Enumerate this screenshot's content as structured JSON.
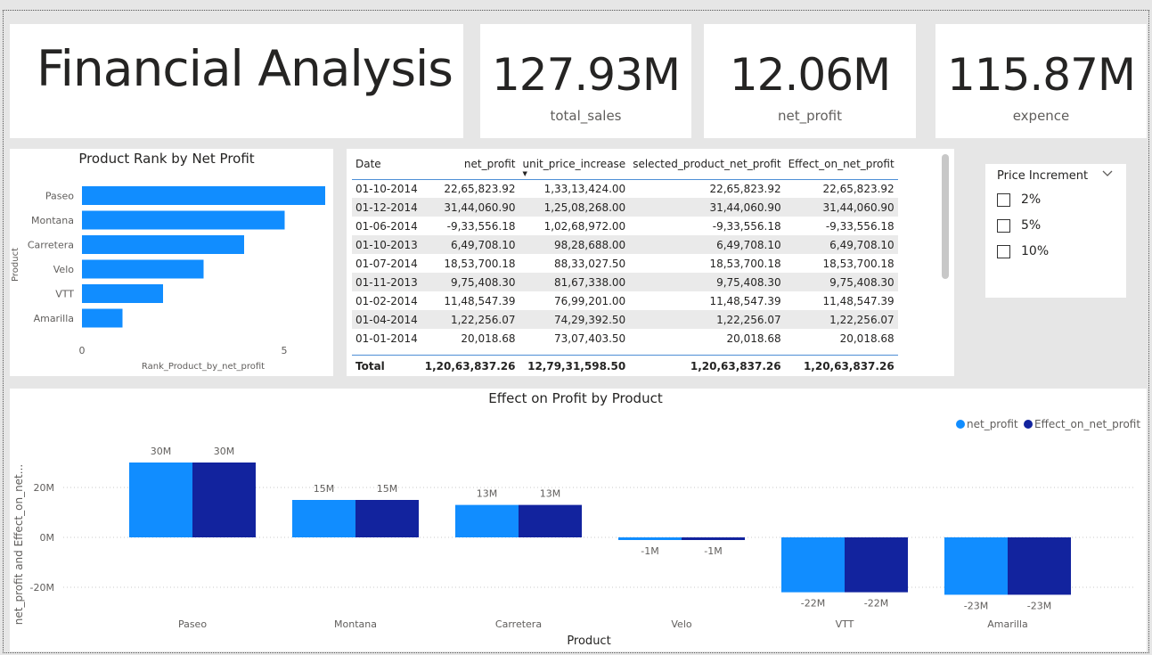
{
  "header": {
    "title": "Financial Analysis"
  },
  "kpis": [
    {
      "value": "127.93M",
      "label": "total_sales"
    },
    {
      "value": "12.06M",
      "label": "net_profit"
    },
    {
      "value": "115.87M",
      "label": "expence"
    }
  ],
  "rank_chart": {
    "title": "Product Rank by Net Profit",
    "xlabel": "Rank_Product_by_net_profit",
    "ylabel": "Product",
    "tick_labels": [
      "0",
      "5"
    ]
  },
  "table": {
    "columns": [
      "Date",
      "net_profit",
      "unit_price_increase",
      "selected_product_net_profit",
      "Effect_on_net_profit"
    ],
    "rows": [
      [
        "01-10-2014",
        "22,65,823.92",
        "1,33,13,424.00",
        "22,65,823.92",
        "22,65,823.92"
      ],
      [
        "01-12-2014",
        "31,44,060.90",
        "1,25,08,268.00",
        "31,44,060.90",
        "31,44,060.90"
      ],
      [
        "01-06-2014",
        "-9,33,556.18",
        "1,02,68,972.00",
        "-9,33,556.18",
        "-9,33,556.18"
      ],
      [
        "01-10-2013",
        "6,49,708.10",
        "98,28,688.00",
        "6,49,708.10",
        "6,49,708.10"
      ],
      [
        "01-07-2014",
        "18,53,700.18",
        "88,33,027.50",
        "18,53,700.18",
        "18,53,700.18"
      ],
      [
        "01-11-2013",
        "9,75,408.30",
        "81,67,338.00",
        "9,75,408.30",
        "9,75,408.30"
      ],
      [
        "01-02-2014",
        "11,48,547.39",
        "76,99,201.00",
        "11,48,547.39",
        "11,48,547.39"
      ],
      [
        "01-04-2014",
        "1,22,256.07",
        "74,29,392.50",
        "1,22,256.07",
        "1,22,256.07"
      ],
      [
        "01-01-2014",
        "20,018.68",
        "73,07,403.50",
        "20,018.68",
        "20,018.68"
      ]
    ],
    "total": [
      "Total",
      "1,20,63,837.26",
      "12,79,31,598.50",
      "1,20,63,837.26",
      "1,20,63,837.26"
    ]
  },
  "slicer": {
    "title": "Price Increment",
    "options": [
      "2%",
      "5%",
      "10%"
    ]
  },
  "effect_chart": {
    "title": "Effect on Profit by Product",
    "xlabel": "Product",
    "ylabel": "net_profit and Effect_on_net...",
    "tick_labels": [
      "20M",
      "0M",
      "-20M"
    ],
    "data_labels_a": [
      "30M",
      "15M",
      "13M",
      "-1M",
      "-22M",
      "-23M"
    ],
    "data_labels_b": [
      "30M",
      "15M",
      "13M",
      "-1M",
      "-22M",
      "-23M"
    ]
  },
  "chart_data": [
    {
      "type": "bar",
      "orientation": "horizontal",
      "title": "Product Rank by Net Profit",
      "xlabel": "Rank_Product_by_net_profit",
      "ylabel": "Product",
      "categories": [
        "Paseo",
        "Montana",
        "Carretera",
        "Velo",
        "VTT",
        "Amarilla"
      ],
      "values": [
        6,
        5,
        4,
        3,
        2,
        1
      ],
      "xlim": [
        0,
        6
      ],
      "grid": false,
      "colors": [
        "#118dff"
      ]
    },
    {
      "type": "bar",
      "title": "Effect on Profit by Product",
      "xlabel": "Product",
      "ylabel": "net_profit and Effect_on_net...",
      "categories": [
        "Paseo",
        "Montana",
        "Carretera",
        "Velo",
        "VTT",
        "Amarilla"
      ],
      "series": [
        {
          "name": "net_profit",
          "values": [
            30,
            15,
            13,
            -1,
            -22,
            -23
          ],
          "color": "#118dff"
        },
        {
          "name": "Effect_on_net_profit",
          "values": [
            30,
            15,
            13,
            -1,
            -22,
            -23
          ],
          "color": "#12239e"
        }
      ],
      "unit": "M",
      "ylim": [
        -30,
        35
      ],
      "grid": true,
      "legend": "top-right"
    }
  ]
}
